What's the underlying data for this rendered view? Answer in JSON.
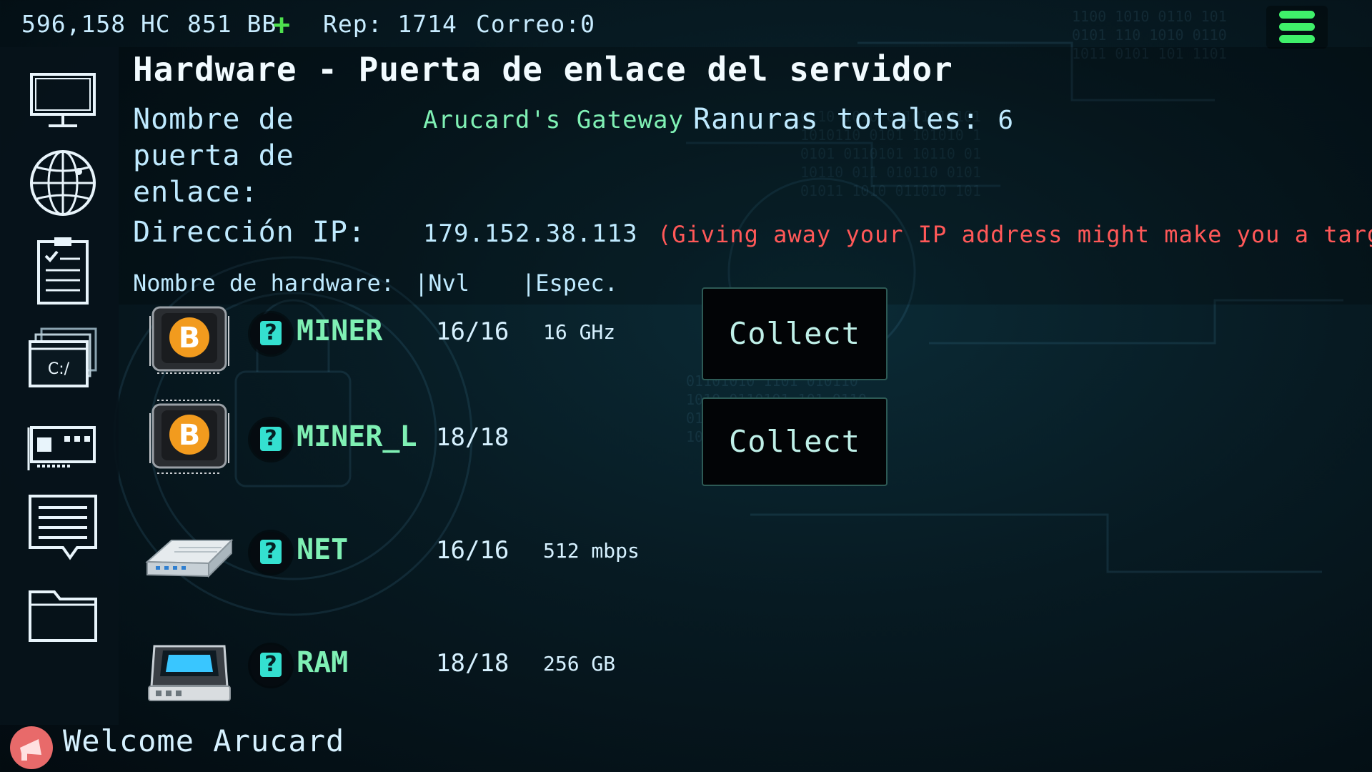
{
  "topbar": {
    "hc": "596,158 HC",
    "bb": "851 BB",
    "rep_label": "Rep:",
    "rep_value": "1714",
    "mail": "Correo:0"
  },
  "sidebar": {
    "items": [
      {
        "icon": "monitor-icon"
      },
      {
        "icon": "globe-icon"
      },
      {
        "icon": "clipboard-icon"
      },
      {
        "icon": "terminal-window-icon"
      },
      {
        "icon": "hardware-card-icon"
      },
      {
        "icon": "chat-icon"
      },
      {
        "icon": "folder-icon"
      }
    ],
    "terminal_text": "C:/"
  },
  "panel": {
    "title": "Hardware - Puerta de enlace del servidor",
    "gateway_name_label": "Nombre de puerta de enlace:",
    "gateway_name_value": "Arucard's Gateway",
    "slots_label": "Ranuras totales:",
    "slots_value": "6",
    "ip_label": "Dirección IP:",
    "ip_value": "179.152.38.113",
    "ip_warning": "(Giving away your IP address might make you a target)",
    "columns": {
      "name": "Nombre de hardware:",
      "level": "|Nvl",
      "spec": "|Espec."
    }
  },
  "hardware": [
    {
      "name": "MINER",
      "level": "16/16",
      "spec": "16 GHz",
      "action": "Collect",
      "icon": "bitcoin-chip-icon"
    },
    {
      "name": "MINER_L",
      "level": "18/18",
      "spec": "",
      "action": "Collect",
      "icon": "bitcoin-chip-icon"
    },
    {
      "name": "NET",
      "level": "16/16",
      "spec": "512 mbps",
      "action": "",
      "icon": "router-icon"
    },
    {
      "name": "RAM",
      "level": "18/18",
      "spec": "256 GB",
      "action": "",
      "icon": "ram-drive-icon"
    }
  ],
  "help_glyph": "?",
  "footer": {
    "welcome": "Welcome Arucard"
  },
  "colors": {
    "accent_green": "#7ff0b4",
    "warning_red": "#ff5858",
    "menu_green": "#3ff06a",
    "help_cyan": "#34e0d0"
  }
}
